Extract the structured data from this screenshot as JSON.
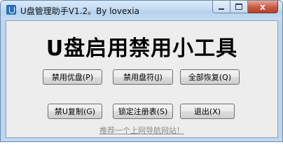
{
  "window": {
    "title": "U盘管理助手V1.2。By lovexia",
    "minimize_label": "",
    "maximize_label": "",
    "close_label": "x"
  },
  "heading": "U盘启用禁用小工具",
  "buttons": {
    "disable_usb": "禁用优盘(P)",
    "disable_drive_letter": "禁用盘符(J)",
    "restore_all": "全部恢复(Q)",
    "disable_u_copy": "禁U复制(G)",
    "lock_registry": "锁定注册表(S)",
    "exit": "退出(X)"
  },
  "footer_link": "推荐一个上网导航网站！",
  "colors": {
    "titlebar": "#c3dbf2",
    "client_bg": "#ededed",
    "close_button": "#c75a43",
    "link": "#8c8c8c"
  }
}
